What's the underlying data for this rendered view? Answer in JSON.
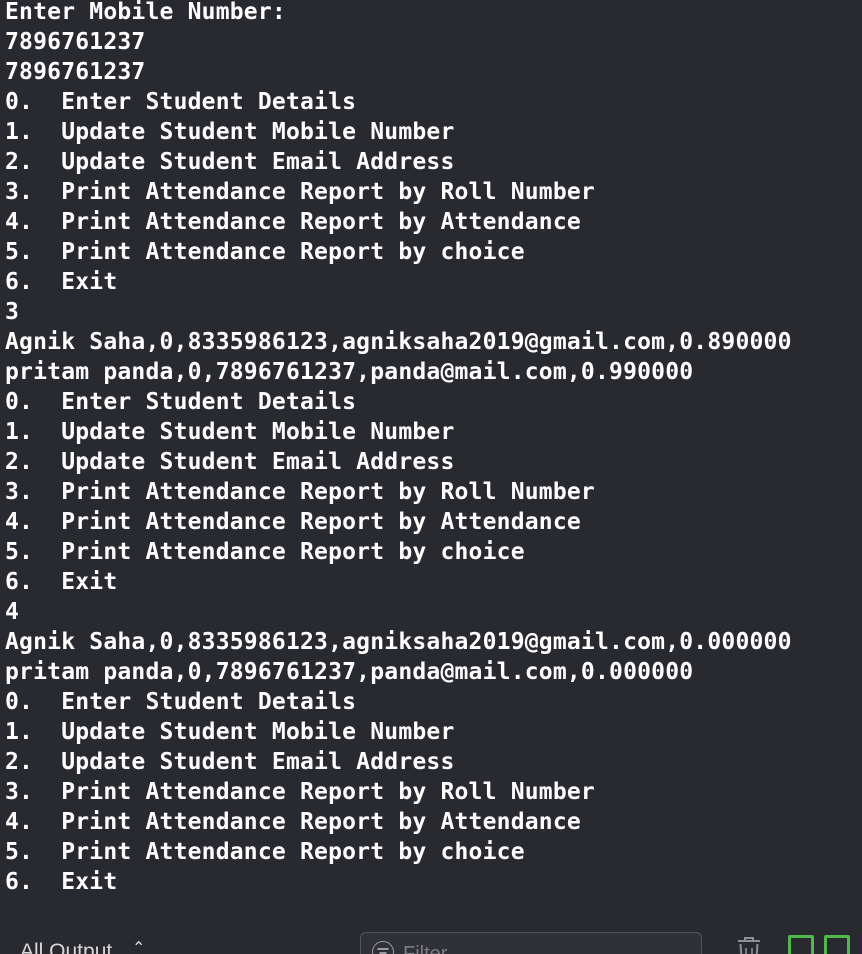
{
  "console": {
    "lines": [
      "Enter Mobile Number:",
      "7896761237",
      "7896761237",
      "0.  Enter Student Details",
      "1.  Update Student Mobile Number",
      "2.  Update Student Email Address",
      "3.  Print Attendance Report by Roll Number",
      "4.  Print Attendance Report by Attendance",
      "5.  Print Attendance Report by choice",
      "6.  Exit",
      "3",
      "Agnik Saha,0,8335986123,agniksaha2019@gmail.com,0.890000",
      "pritam panda,0,7896761237,panda@mail.com,0.990000",
      "0.  Enter Student Details",
      "1.  Update Student Mobile Number",
      "2.  Update Student Email Address",
      "3.  Print Attendance Report by Roll Number",
      "4.  Print Attendance Report by Attendance",
      "5.  Print Attendance Report by choice",
      "6.  Exit",
      "4",
      "Agnik Saha,0,8335986123,agniksaha2019@gmail.com,0.000000",
      "pritam panda,0,7896761237,panda@mail.com,0.000000",
      "0.  Enter Student Details",
      "1.  Update Student Mobile Number",
      "2.  Update Student Email Address",
      "3.  Print Attendance Report by Roll Number",
      "4.  Print Attendance Report by Attendance",
      "5.  Print Attendance Report by choice",
      "6.  Exit"
    ]
  },
  "toolbar": {
    "output_selector": "All Output",
    "filter_placeholder": "Filter",
    "filter_value": ""
  },
  "icons": {
    "output_chevron": "chevron-up-icon",
    "filter": "filter-icon",
    "trash": "trash-icon",
    "split_view": "split-view-icon"
  },
  "colors": {
    "background": "#292a30",
    "text": "#ffffff",
    "accent_green": "#4fb94a"
  }
}
